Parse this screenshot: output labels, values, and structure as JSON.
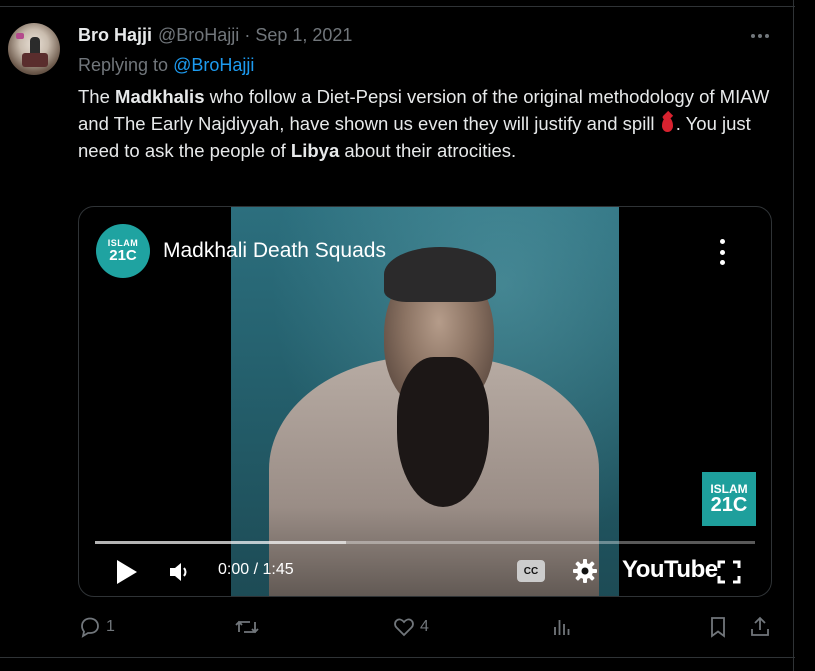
{
  "tweet": {
    "display_name": "Bro Hajji",
    "handle": "@BroHajji",
    "separator": "·",
    "date": "Sep 1, 2021",
    "reply_prefix": "Replying to ",
    "reply_to": "@BroHajji",
    "text": {
      "p1": "The ",
      "b1": "Madkhalis",
      "p2": " who follow a Diet-Pepsi version of the original methodology of MIAW and The Early Najdiyyah, have shown us even they will justify and spill ",
      "p3": ". You just need to ask the people of ",
      "b2": "Libya",
      "p4": " about their atrocities."
    }
  },
  "video": {
    "title": "Madkhali Death Squads",
    "channel_logo_line1": "ISLAM",
    "channel_logo_line2": "21C",
    "watermark_line1": "ISLAM",
    "watermark_line2": "21C",
    "time": "0:00 / 1:45",
    "progress": 0.38,
    "cc_label": "CC",
    "brand": "YouTube",
    "colors": {
      "logo": "#1fa3a1",
      "wall": "#2c6f7e"
    }
  },
  "actions": {
    "replies": "1",
    "retweets": "",
    "likes": "4",
    "views": ""
  },
  "colors": {
    "background": "#000000",
    "text": "#e7e9ea",
    "muted": "#71767b",
    "link": "#1d9bf0",
    "blood_drop": "#d8222f"
  },
  "icons": [
    "more-icon",
    "blood-drop-emoji",
    "video-more-icon",
    "play-icon",
    "volume-icon",
    "cc-icon",
    "gear-icon",
    "fullscreen-icon",
    "reply-icon",
    "retweet-icon",
    "like-icon",
    "views-icon",
    "bookmark-icon",
    "share-icon"
  ]
}
